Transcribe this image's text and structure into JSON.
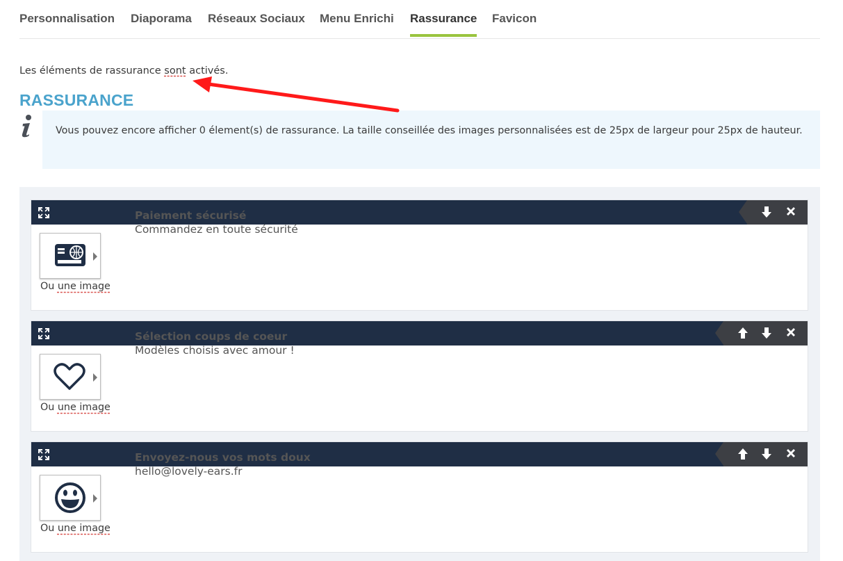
{
  "tabs": [
    {
      "label": "Personnalisation",
      "active": false
    },
    {
      "label": "Diaporama",
      "active": false
    },
    {
      "label": "Réseaux Sociaux",
      "active": false
    },
    {
      "label": "Menu Enrichi",
      "active": false
    },
    {
      "label": "Rassurance",
      "active": true
    },
    {
      "label": "Favicon",
      "active": false
    }
  ],
  "status": {
    "prefix": "Les éléments de rassurance ",
    "verb": "sont",
    "suffix": " activés."
  },
  "section_title": "RASSURANCE",
  "info": {
    "text": "Vous pouvez encore afficher 0 élement(s) de rassurance. La taille conseillée des images personnalisées est de 25px de largeur pour 25px de hauteur."
  },
  "items": [
    {
      "title": "Paiement sécurisé",
      "subtitle": "Commandez en toute sécurité",
      "icon": "credit-card-globe-icon",
      "image_prefix": "Ou ",
      "image_link": "une image"
    },
    {
      "title": "Sélection coups de coeur",
      "subtitle": "Modèles choisis avec amour !",
      "icon": "heart-icon",
      "image_prefix": "Ou ",
      "image_link": "une image"
    },
    {
      "title": "Envoyez-nous vos mots doux",
      "subtitle": "hello@lovely-ears.fr",
      "icon": "smiley-icon",
      "image_prefix": "Ou ",
      "image_link": "une image"
    }
  ],
  "colors": {
    "accent": "#9ac43f",
    "title": "#4aa3cc",
    "bar": "#1f2e45",
    "info_bg": "#eef7fd",
    "arrow": "#ff1a1a"
  }
}
